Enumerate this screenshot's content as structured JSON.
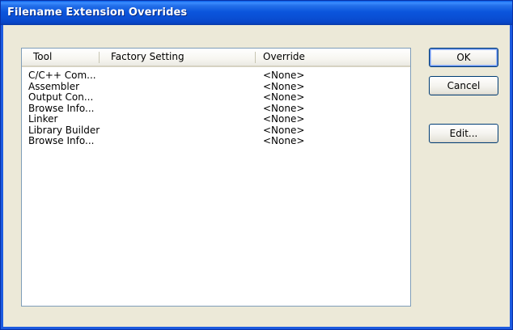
{
  "window": {
    "title": "Filename Extension Overrides"
  },
  "list": {
    "columns": [
      "Tool",
      "Factory Setting",
      "Override"
    ],
    "rows": [
      {
        "tool": "C/C++ Com...",
        "factory": "",
        "override": "<None>"
      },
      {
        "tool": "Assembler",
        "factory": "",
        "override": "<None>"
      },
      {
        "tool": "Output Con...",
        "factory": "",
        "override": "<None>"
      },
      {
        "tool": "Browse Info...",
        "factory": "",
        "override": "<None>"
      },
      {
        "tool": "Linker",
        "factory": "",
        "override": "<None>"
      },
      {
        "tool": "Library Builder",
        "factory": "",
        "override": "<None>"
      },
      {
        "tool": "Browse Info...",
        "factory": "",
        "override": "<None>"
      }
    ]
  },
  "buttons": {
    "ok": "OK",
    "cancel": "Cancel",
    "edit": "Edit..."
  }
}
